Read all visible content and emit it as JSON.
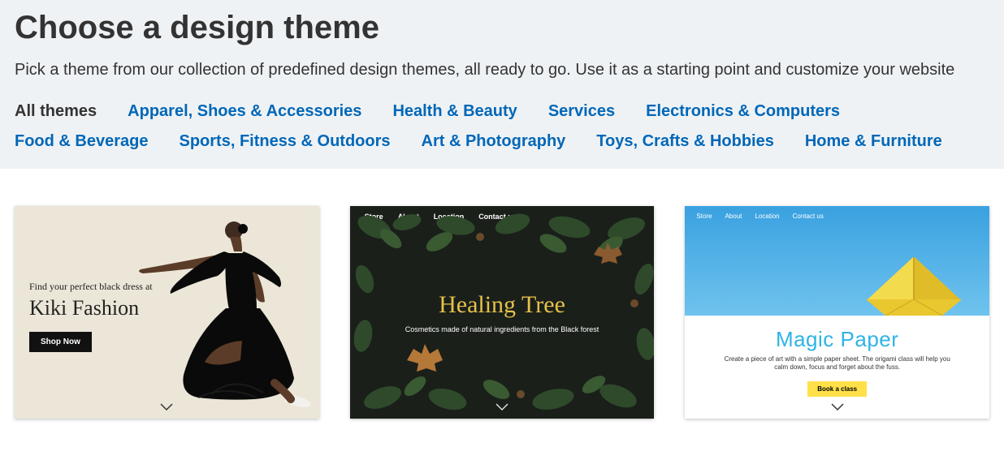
{
  "header": {
    "title": "Choose a design theme",
    "subtitle": "Pick a theme from our collection of predefined design themes, all ready to go. Use it as a starting point and customize your website"
  },
  "categories": [
    {
      "label": "All themes",
      "active": true
    },
    {
      "label": "Apparel, Shoes & Accessories",
      "active": false
    },
    {
      "label": "Health & Beauty",
      "active": false
    },
    {
      "label": "Services",
      "active": false
    },
    {
      "label": "Electronics & Computers",
      "active": false
    },
    {
      "label": "Food & Beverage",
      "active": false
    },
    {
      "label": "Sports, Fitness & Outdoors",
      "active": false
    },
    {
      "label": "Art & Photography",
      "active": false
    },
    {
      "label": "Toys, Crafts & Hobbies",
      "active": false
    },
    {
      "label": "Home & Furniture",
      "active": false
    }
  ],
  "themes": {
    "kiki": {
      "tagline": "Find your perfect black dress at",
      "brand": "Kiki Fashion",
      "cta": "Shop Now"
    },
    "healing": {
      "nav": [
        "Store",
        "About",
        "Location",
        "Contact us"
      ],
      "brand": "Healing Tree",
      "sub": "Cosmetics made of natural ingredients from the Black forest"
    },
    "magic": {
      "nav": [
        "Store",
        "About",
        "Location",
        "Contact us"
      ],
      "brand": "Magic Paper",
      "desc": "Create a piece of art with a simple paper sheet. The origami class will help you calm down, focus and forget about the fuss.",
      "cta": "Book a class"
    }
  }
}
